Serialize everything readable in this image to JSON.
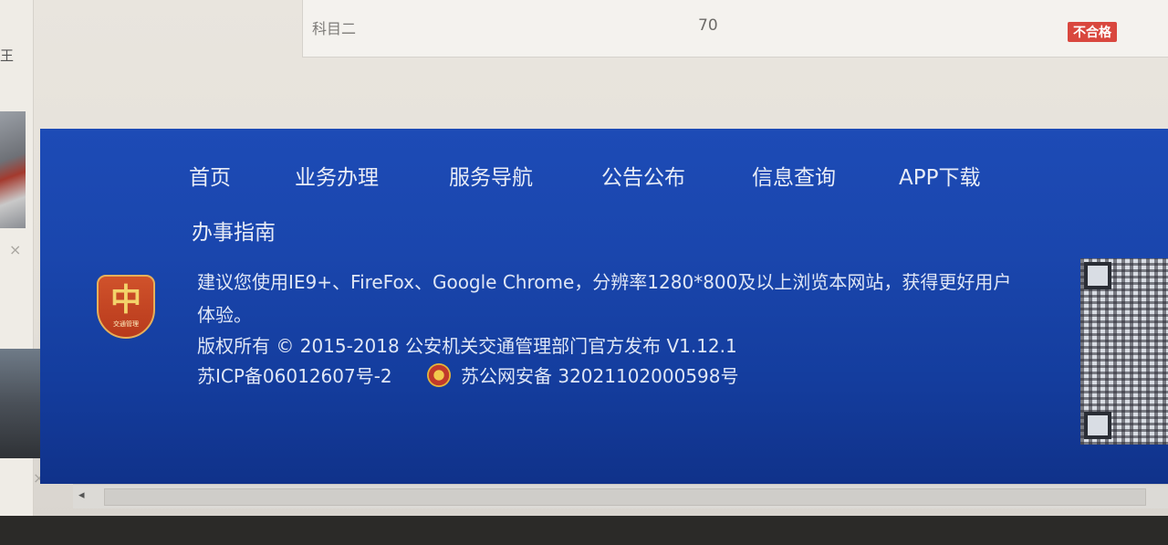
{
  "result": {
    "subject": "科目二",
    "score": "70",
    "status": "不合格"
  },
  "left": {
    "edge_char": "王"
  },
  "nav": [
    {
      "label": "首页"
    },
    {
      "label": "业务办理"
    },
    {
      "label": "服务导航"
    },
    {
      "label": "公告公布"
    },
    {
      "label": "信息查询"
    },
    {
      "label": "APP下载"
    },
    {
      "label": "办事指南"
    }
  ],
  "footer": {
    "logo_glyph": "中",
    "logo_text": "交通管理",
    "browser_tip_line1": "建议您使用IE9+、FireFox、Google Chrome，分辨率1280*800及以上浏览本网站，获得更好用户",
    "browser_tip_line2": "体验。",
    "copyright": "版权所有 © 2015-2018 公安机关交通管理部门官方发布 V1.12.1",
    "icp": "苏ICP备06012607号-2",
    "beian": "苏公网安备 32021102000598号"
  },
  "colors": {
    "footer_bg": "#1a46ad",
    "fail_badge": "#d9473e"
  },
  "icons": {
    "close": "×",
    "scroll_left": "◂"
  }
}
